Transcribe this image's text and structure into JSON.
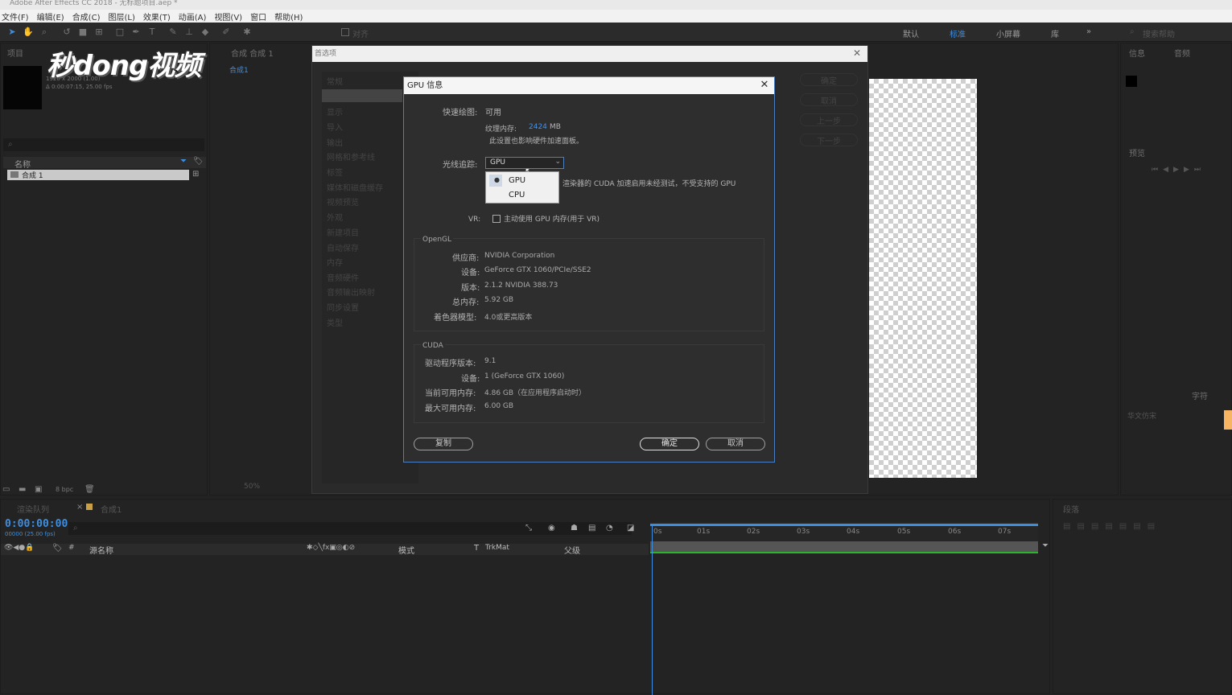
{
  "app": {
    "window_title": "Adobe After Effects CC 2018 - 无标题项目.aep *",
    "watermark": "秒dong视频"
  },
  "menu": [
    "文件(F)",
    "编辑(E)",
    "合成(C)",
    "图层(L)",
    "效果(T)",
    "动画(A)",
    "视图(V)",
    "窗口",
    "帮助(H)"
  ],
  "toolbar": {
    "align_label": "对齐",
    "workspaces": [
      "默认",
      "标准",
      "小屏幕",
      "库"
    ],
    "search_placeholder": "搜索帮助"
  },
  "project_panel": {
    "tab": "项目",
    "comp_info_1": "1920 x 2000 (1.00)",
    "comp_info_2": "Δ 0:00:07:15, 25.00 fps",
    "column_name": "名称",
    "item": "合成 1",
    "bpc": "8 bpc"
  },
  "comp_panel": {
    "tab": "合成 合成 1",
    "flow_label": "合成1",
    "zoom": "50%"
  },
  "prefs_dialog": {
    "title": "首选项",
    "categories": [
      "常规",
      "",
      "显示",
      "导入",
      "输出",
      "网格和参考线",
      "标签",
      "媒体和磁盘缓存",
      "视频预览",
      "外观",
      "新建项目",
      "自动保存",
      "内存",
      "音频硬件",
      "音频输出映射",
      "同步设置",
      "类型"
    ],
    "buttons": [
      "确定",
      "取消",
      "上一步",
      "下一步"
    ]
  },
  "gpu_dialog": {
    "title": "GPU 信息",
    "fast_draw_label": "快速绘图:",
    "fast_draw_value": "可用",
    "texture_memory_label": "纹理内存:",
    "texture_memory_value": "2424",
    "texture_memory_unit": "MB",
    "texture_note": "此设置也影响硬件加速面板。",
    "raytracer_label": "光线追踪:",
    "raytracer_selected": "GPU",
    "raytracer_options": [
      "GPU",
      "CPU"
    ],
    "cuda_warning": "渲染器的 CUDA 加速启用未经测试，不受支持的 GPU",
    "vr_label": "VR:",
    "vr_checkbox": "主动使用 GPU 内存(用于 VR)",
    "opengl": {
      "title": "OpenGL",
      "vendor_label": "供应商:",
      "vendor": "NVIDIA Corporation",
      "device_label": "设备:",
      "device": "GeForce GTX 1060/PCIe/SSE2",
      "version_label": "版本:",
      "version": "2.1.2 NVIDIA 388.73",
      "memory_label": "总内存:",
      "memory": "5.92 GB",
      "shader_label": "着色器模型:",
      "shader": "4.0或更高版本"
    },
    "cuda": {
      "title": "CUDA",
      "driver_label": "驱动程序版本:",
      "driver": "9.1",
      "device_label": "设备:",
      "device": "1 (GeForce GTX 1060)",
      "current_label": "当前可用内存:",
      "current": "4.86 GB（在应用程序启动时）",
      "max_label": "最大可用内存:",
      "max": "6.00 GB"
    },
    "copy_button": "复制",
    "ok_button": "确定",
    "cancel_button": "取消"
  },
  "right_panels": {
    "info_tab": "信息",
    "audio_tab": "音频",
    "preview_tab": "预览",
    "character_tab": "字符",
    "paragraph_tab": "段落",
    "font": "华文仿宋"
  },
  "timeline": {
    "render_queue_tab": "渲染队列",
    "comp_tab": "合成1",
    "timecode": "0:00:00:00",
    "timecode_sub": "00000 (25.00 fps)",
    "col_source": "源名称",
    "col_mode": "模式",
    "col_t": "T",
    "col_trkmat": "TrkMat",
    "col_parent": "父级",
    "ruler": [
      "0s",
      "01s",
      "02s",
      "03s",
      "04s",
      "05s",
      "06s",
      "07s"
    ]
  }
}
